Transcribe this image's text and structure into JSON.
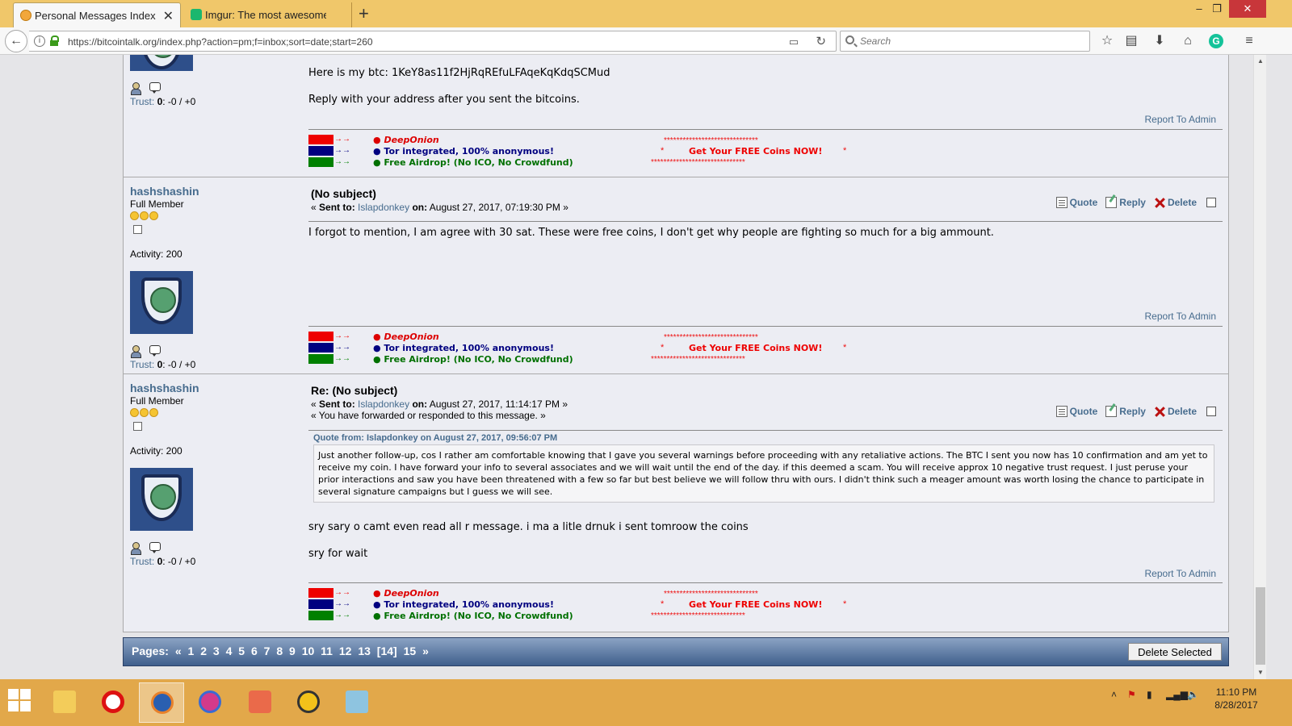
{
  "browser": {
    "tabs": [
      {
        "title": "Personal Messages Index",
        "active": true
      },
      {
        "title": "Imgur: The most awesome images on the Internet",
        "active": false
      }
    ],
    "url": "https://bitcointalk.org/index.php?action=pm;f=inbox;sort=date;start=260",
    "search_placeholder": "Search"
  },
  "common": {
    "trust_label": "Trust:",
    "trust_value": "0",
    "trust_scores": ": -0 / +0",
    "report": "Report To Admin",
    "quote": "Quote",
    "reply": "Reply",
    "delete": "Delete",
    "sent_to_label": "Sent to:",
    "on_label": "on:",
    "open_quote": "«",
    "close_quote": "»"
  },
  "signature": {
    "line1_bullet": "●",
    "line1_brand": "DeepOnion",
    "line2": "● Tor integrated, 100% anonymous!",
    "line3": "● Free Airdrop! (No ICO, No Crowdfund)",
    "arrow": "→→",
    "stars_top": "******************************",
    "stars_bottom": "******************************",
    "star_single": "*",
    "free_coins": "Get Your FREE Coins NOW!"
  },
  "messages": [
    {
      "body_lines": [
        "Here is my btc: 1KeY8as11f2HjRqREfuLFAqeKqKdqSCMud",
        "Reply with your address after you sent the bitcoins."
      ]
    },
    {
      "poster": {
        "name": "hashshashin",
        "rank": "Full Member",
        "activity": "Activity: 200"
      },
      "subject": "(No subject)",
      "recipient": "Islapdonkey",
      "date": "August 27, 2017, 07:19:30 PM",
      "body": "I forgot to mention,  I am agree with 30 sat. These were free coins, I don't get why people are fighting so much for a big ammount."
    },
    {
      "poster": {
        "name": "hashshashin",
        "rank": "Full Member",
        "activity": "Activity: 200"
      },
      "subject": "Re: (No subject)",
      "recipient": "Islapdonkey",
      "date": "August 27, 2017, 11:14:17 PM",
      "forwarded": "« You have forwarded or responded to this message. »",
      "quote_header": "Quote from: Islapdonkey on August 27, 2017, 09:56:07 PM",
      "quote_text": "Just another follow-up, cos I rather am comfortable knowing that I gave you several warnings before proceeding with any retaliative actions. The BTC I sent you now has 10 confirmation and am yet to receive my coin. I have forward your info to several associates and we will wait until the end of the day. if this deemed a scam. You will receive approx 10 negative trust request. I just peruse your prior interactions and saw you have been threatened with a few so far but best believe we will follow thru with ours. I didn't think such a meager amount was worth losing the chance to participate in several signature campaigns but I guess we will see.",
      "body_lines": [
        "sry sary o camt even read all r message. i ma a litle drnuk i sent tomroow the coins",
        "sry for wait"
      ]
    }
  ],
  "pagination": {
    "label": "Pages:",
    "prev": "«",
    "pages": [
      "1",
      "2",
      "3",
      "4",
      "5",
      "6",
      "7",
      "8",
      "9",
      "10",
      "11",
      "12",
      "13",
      "[14]",
      "15"
    ],
    "next": "»"
  },
  "delete_selected": "Delete Selected",
  "clock": {
    "time": "11:10 PM",
    "date": "8/28/2017"
  },
  "colors": {
    "link": "#476c8e",
    "tabbar": "#f0c76a",
    "taskbar": "#e2a84a"
  }
}
